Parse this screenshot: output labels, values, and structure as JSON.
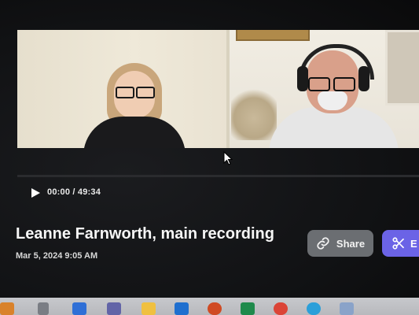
{
  "player": {
    "time_display": "00:00 / 49:34",
    "progress": 0.0,
    "icons": {
      "play": "play-icon"
    }
  },
  "recording": {
    "title": "Leanne Farnworth, main recording",
    "date": "Mar 5, 2024 9:05 AM"
  },
  "actions": {
    "share_label": "Share",
    "clip_label": "E",
    "share_icon": "link-icon",
    "clip_icon": "scissors-icon"
  },
  "colors": {
    "background": "#111214",
    "share_button": "#6b6e72",
    "clip_button": "#6b63e6",
    "text": "#f6f6f6"
  },
  "taskbar": {
    "icons": [
      "start-icon",
      "task-view-icon",
      "mail-icon",
      "teams-icon",
      "file-explorer-icon",
      "outlook-icon",
      "powerpoint-icon",
      "excel-icon",
      "chrome-icon",
      "edge-icon",
      "calendar-icon"
    ]
  }
}
